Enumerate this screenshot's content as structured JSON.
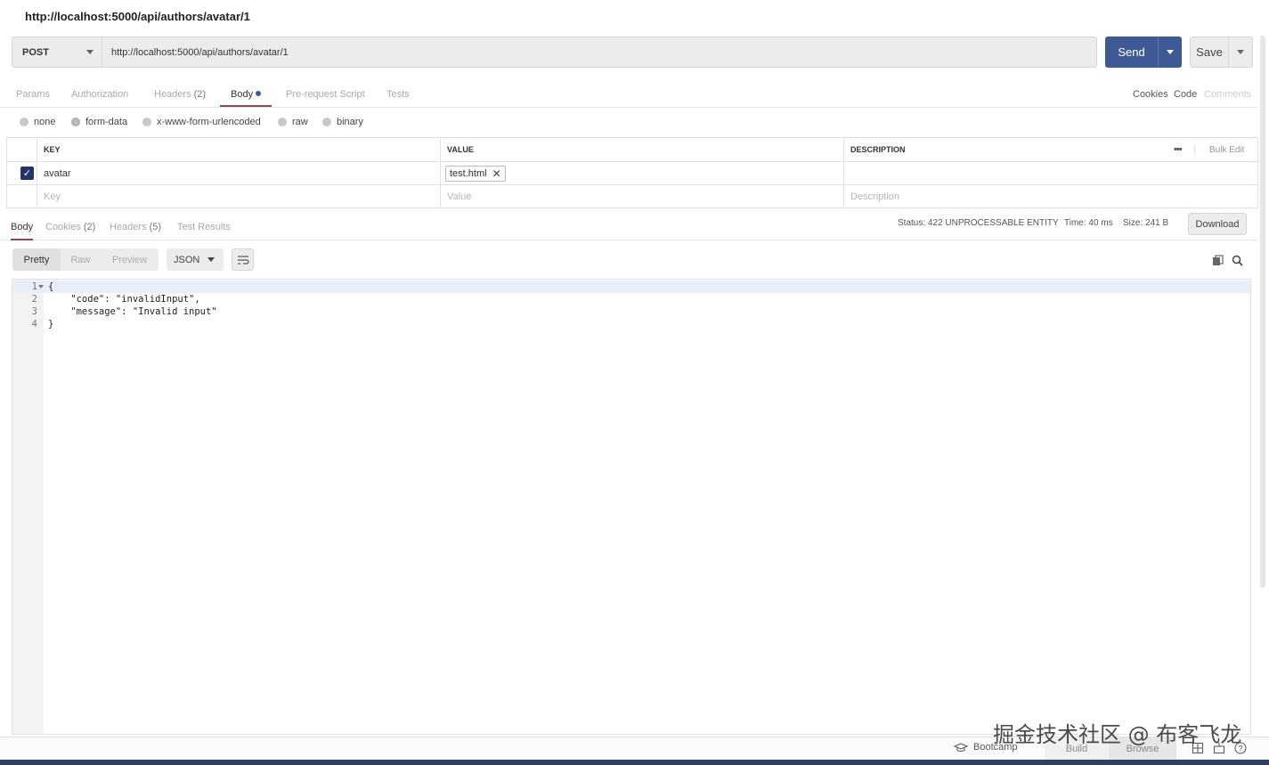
{
  "title": "http://localhost:5000/api/authors/avatar/1",
  "request": {
    "method": "POST",
    "url": "http://localhost:5000/api/authors/avatar/1",
    "send_label": "Send",
    "save_label": "Save"
  },
  "request_tabs": {
    "params": "Params",
    "authorization": "Authorization",
    "headers": "Headers",
    "headers_count": "(2)",
    "body": "Body",
    "prerequest": "Pre-request Script",
    "tests": "Tests",
    "cookies": "Cookies",
    "code": "Code",
    "comments": "Comments"
  },
  "body_types": {
    "none": "none",
    "form_data": "form-data",
    "urlencoded": "x-www-form-urlencoded",
    "raw": "raw",
    "binary": "binary",
    "selected": "form-data"
  },
  "params_table": {
    "header_key": "KEY",
    "header_value": "VALUE",
    "header_description": "DESCRIPTION",
    "more": "•••",
    "bulk_edit": "Bulk Edit",
    "row_key": "avatar",
    "row_value": "test.html",
    "row_checked": true,
    "placeholder_key": "Key",
    "placeholder_value": "Value",
    "placeholder_description": "Description"
  },
  "response_tabs": {
    "body": "Body",
    "cookies": "Cookies",
    "cookies_count": "(2)",
    "headers": "Headers",
    "headers_count": "(5)",
    "test_results": "Test Results",
    "status": "Status: 422 UNPROCESSABLE ENTITY",
    "time": "Time: 40 ms",
    "size": "Size: 241 B",
    "download": "Download"
  },
  "view_toolbar": {
    "pretty": "Pretty",
    "raw": "Raw",
    "preview": "Preview",
    "format": "JSON"
  },
  "response_body": {
    "lines": [
      {
        "n": "1",
        "text": "{"
      },
      {
        "n": "2",
        "text": "    \"code\": \"invalidInput\","
      },
      {
        "n": "3",
        "text": "    \"message\": \"Invalid input\""
      },
      {
        "n": "4",
        "text": "}"
      }
    ]
  },
  "footer": {
    "bootcamp": "Bootcamp",
    "build": "Build",
    "browse": "Browse"
  },
  "watermark": "掘金技术社区 @ 布客飞龙",
  "colors": {
    "send_button": "#3e5a94",
    "checkbox": "#25336a",
    "active_tab_underline": "#8b4a4a",
    "footer_bar": "#2f3e63"
  }
}
